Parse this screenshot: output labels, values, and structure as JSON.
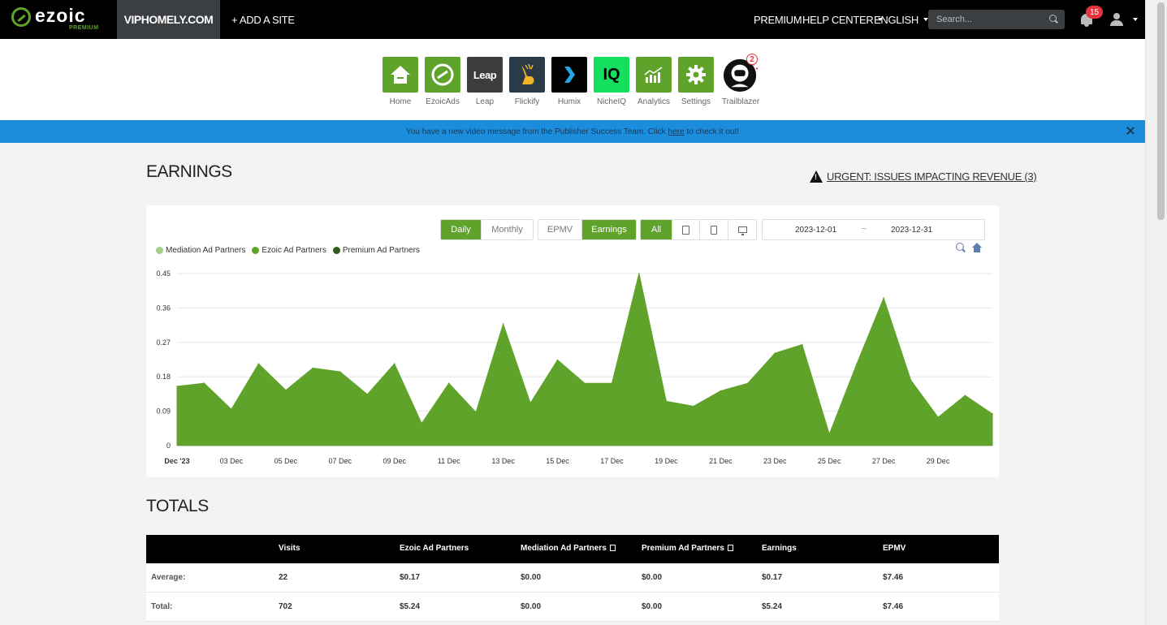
{
  "topbar": {
    "logo_text": "ezoic",
    "logo_sub": "PREMIUM",
    "site": "VIPHOMELY.COM",
    "add_site": "+ ADD A SITE",
    "premium": "PREMIUM",
    "help_center": "HELP CENTER",
    "language": "ENGLISH",
    "search_placeholder": "Search...",
    "notifications_count": "15"
  },
  "apps": [
    {
      "label": "Home",
      "icon": "home-icon"
    },
    {
      "label": "EzoicAds",
      "icon": "ezoic-ads-icon"
    },
    {
      "label": "Leap",
      "icon": "leap-icon",
      "tile_text": "Leap"
    },
    {
      "label": "Flickify",
      "icon": "flickify-icon"
    },
    {
      "label": "Humix",
      "icon": "humix-icon"
    },
    {
      "label": "NicheIQ",
      "icon": "nicheiq-icon",
      "tile_text": "IQ"
    },
    {
      "label": "Analytics",
      "icon": "analytics-icon"
    },
    {
      "label": "Settings",
      "icon": "gear-icon"
    },
    {
      "label": "Trailblazer",
      "icon": "astronaut-icon",
      "badge": "2"
    }
  ],
  "notice": {
    "before": "You have a new video message from the Publisher Success Team. Click",
    "link": "here",
    "after": "to check it out!"
  },
  "earnings": {
    "title": "EARNINGS",
    "urgent": "URGENT: ISSUES IMPACTING REVENUE (3)",
    "period_buttons": [
      "Daily",
      "Monthly"
    ],
    "period_active": "Daily",
    "metric_buttons": [
      "EPMV",
      "Earnings"
    ],
    "metric_active": "Earnings",
    "device_all": "All",
    "date_start": "2023-12-01",
    "date_sep": "~",
    "date_end": "2023-12-31"
  },
  "colors": {
    "accent": "#5fa32a",
    "mediation": "#a6cf85",
    "ezoic": "#5fa32a",
    "premium": "#2f5d17",
    "notice_bg": "#1b8ddc"
  },
  "chart_data": {
    "type": "area",
    "legend": [
      "Mediation Ad Partners",
      "Ezoic Ad Partners",
      "Premium Ad Partners"
    ],
    "legend_colors": [
      "#a6cf85",
      "#5fa32a",
      "#2f5d17"
    ],
    "y_ticks": [
      "0",
      "0.09",
      "0.18",
      "0.27",
      "0.36",
      "0.45"
    ],
    "ylim": [
      0,
      0.45
    ],
    "x_tick_labels": [
      "Dec '23",
      "03 Dec",
      "05 Dec",
      "07 Dec",
      "09 Dec",
      "11 Dec",
      "13 Dec",
      "15 Dec",
      "17 Dec",
      "19 Dec",
      "21 Dec",
      "23 Dec",
      "25 Dec",
      "27 Dec",
      "29 Dec"
    ],
    "x": [
      "2023-12-01",
      "2023-12-02",
      "2023-12-03",
      "2023-12-04",
      "2023-12-05",
      "2023-12-06",
      "2023-12-07",
      "2023-12-08",
      "2023-12-09",
      "2023-12-10",
      "2023-12-11",
      "2023-12-12",
      "2023-12-13",
      "2023-12-14",
      "2023-12-15",
      "2023-12-16",
      "2023-12-17",
      "2023-12-18",
      "2023-12-19",
      "2023-12-20",
      "2023-12-21",
      "2023-12-22",
      "2023-12-23",
      "2023-12-24",
      "2023-12-25",
      "2023-12-26",
      "2023-12-27",
      "2023-12-28",
      "2023-12-29",
      "2023-12-30",
      "2023-12-31"
    ],
    "series": [
      {
        "name": "Ezoic Ad Partners",
        "values": [
          0.155,
          0.163,
          0.095,
          0.214,
          0.145,
          0.203,
          0.193,
          0.134,
          0.214,
          0.058,
          0.163,
          0.087,
          0.318,
          0.111,
          0.224,
          0.163,
          0.163,
          0.45,
          0.116,
          0.103,
          0.143,
          0.163,
          0.242,
          0.264,
          0.03,
          0.212,
          0.386,
          0.171,
          0.074,
          0.131,
          0.083
        ]
      }
    ]
  },
  "totals": {
    "title": "TOTALS",
    "columns": [
      "",
      "Visits",
      "Ezoic Ad Partners",
      "Mediation Ad Partners",
      "Premium Ad Partners",
      "Earnings",
      "EPMV"
    ],
    "rows": [
      [
        "Average:",
        "22",
        "$0.17",
        "$0.00",
        "$0.00",
        "$0.17",
        "$7.46"
      ],
      [
        "Total:",
        "702",
        "$5.24",
        "$0.00",
        "$0.00",
        "$5.24",
        "$7.46"
      ]
    ]
  }
}
